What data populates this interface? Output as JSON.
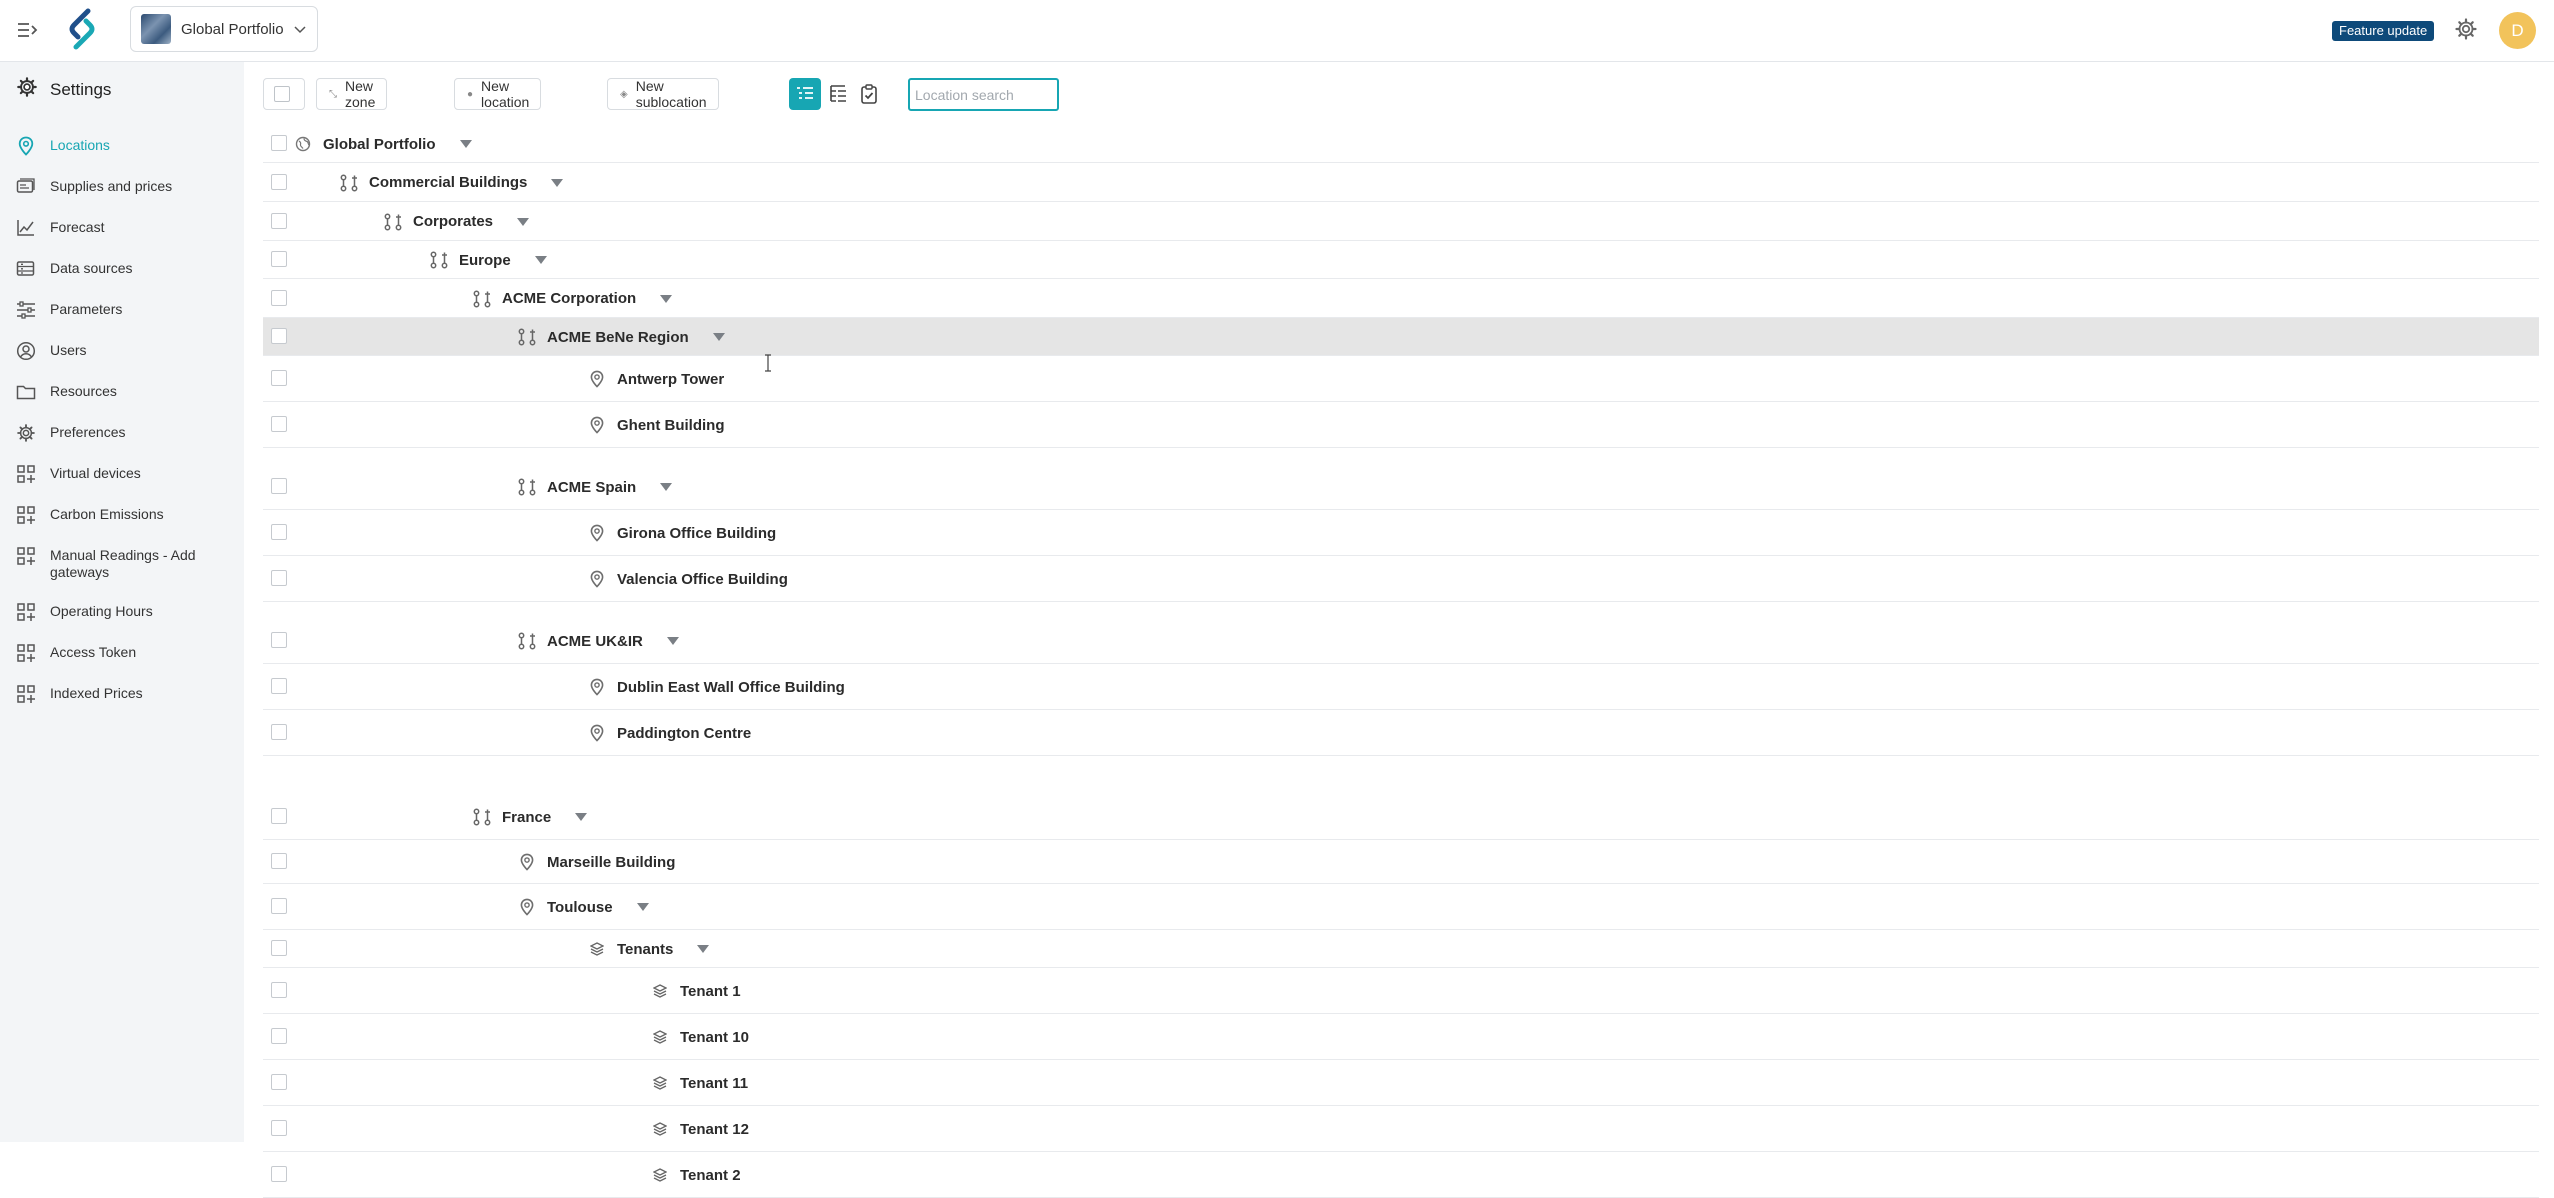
{
  "header": {
    "portfolio": "Global Portfolio",
    "feature_badge": "Feature update",
    "avatar_initial": "D"
  },
  "sidebar": {
    "title": "Settings",
    "items": [
      {
        "label": "Locations",
        "icon": "location-pin-icon",
        "active": true
      },
      {
        "label": "Supplies and prices",
        "icon": "invoice-icon"
      },
      {
        "label": "Forecast",
        "icon": "chart-line-icon"
      },
      {
        "label": "Data sources",
        "icon": "database-icon"
      },
      {
        "label": "Parameters",
        "icon": "sliders-icon"
      },
      {
        "label": "Users",
        "icon": "user-circle-icon"
      },
      {
        "label": "Resources",
        "icon": "folder-icon"
      },
      {
        "label": "Preferences",
        "icon": "gear-icon"
      },
      {
        "label": "Virtual devices",
        "icon": "grid-icon"
      },
      {
        "label": "Carbon Emissions",
        "icon": "grid-icon"
      },
      {
        "label": "Manual Readings - Add gateways",
        "icon": "grid-icon"
      },
      {
        "label": "Operating Hours",
        "icon": "grid-icon"
      },
      {
        "label": "Access Token",
        "icon": "grid-icon"
      },
      {
        "label": "Indexed Prices",
        "icon": "grid-icon"
      }
    ]
  },
  "toolbar": {
    "new_zone": "New zone",
    "new_location": "New location",
    "new_sublocation": "New sublocation",
    "search_placeholder": "Location search"
  },
  "accent_color": "#17a6b3",
  "tree": [
    {
      "label": "Global Portfolio",
      "type": "portfolio",
      "level": 0,
      "caret": true
    },
    {
      "label": "Commercial Buildings",
      "type": "zone",
      "level": 1,
      "caret": true
    },
    {
      "label": "Corporates",
      "type": "zone",
      "level": 2,
      "caret": true
    },
    {
      "label": "Europe",
      "type": "zone",
      "level": 3,
      "caret": true
    },
    {
      "label": "ACME Corporation",
      "type": "zone",
      "level": 4,
      "caret": true
    },
    {
      "label": "ACME BeNe Region",
      "type": "zone",
      "level": 5,
      "caret": true,
      "selected": true
    },
    {
      "label": "Antwerp Tower",
      "type": "location",
      "level": 6
    },
    {
      "label": "Ghent Building",
      "type": "location",
      "level": 6
    },
    {
      "label": "ACME Spain",
      "type": "zone",
      "level": 5,
      "caret": true
    },
    {
      "label": "Girona Office Building",
      "type": "location",
      "level": 6
    },
    {
      "label": "Valencia Office Building",
      "type": "location",
      "level": 6
    },
    {
      "label": "ACME UK&IR",
      "type": "zone",
      "level": 5,
      "caret": true
    },
    {
      "label": "Dublin East Wall Office Building",
      "type": "location",
      "level": 6
    },
    {
      "label": "Paddington Centre",
      "type": "location",
      "level": 6
    },
    {
      "label": "France",
      "type": "zone",
      "level": 4,
      "caret": true
    },
    {
      "label": "Marseille Building",
      "type": "location",
      "level": 5
    },
    {
      "label": "Toulouse",
      "type": "location",
      "level": 5,
      "caret": true
    },
    {
      "label": "Tenants",
      "type": "sublocation",
      "level": 6,
      "caret": true
    },
    {
      "label": "Tenant 1",
      "type": "sublocation",
      "level": 7
    },
    {
      "label": "Tenant 10",
      "type": "sublocation",
      "level": 7
    },
    {
      "label": "Tenant 11",
      "type": "sublocation",
      "level": 7
    },
    {
      "label": "Tenant 12",
      "type": "sublocation",
      "level": 7
    },
    {
      "label": "Tenant 2",
      "type": "sublocation",
      "level": 7
    }
  ]
}
